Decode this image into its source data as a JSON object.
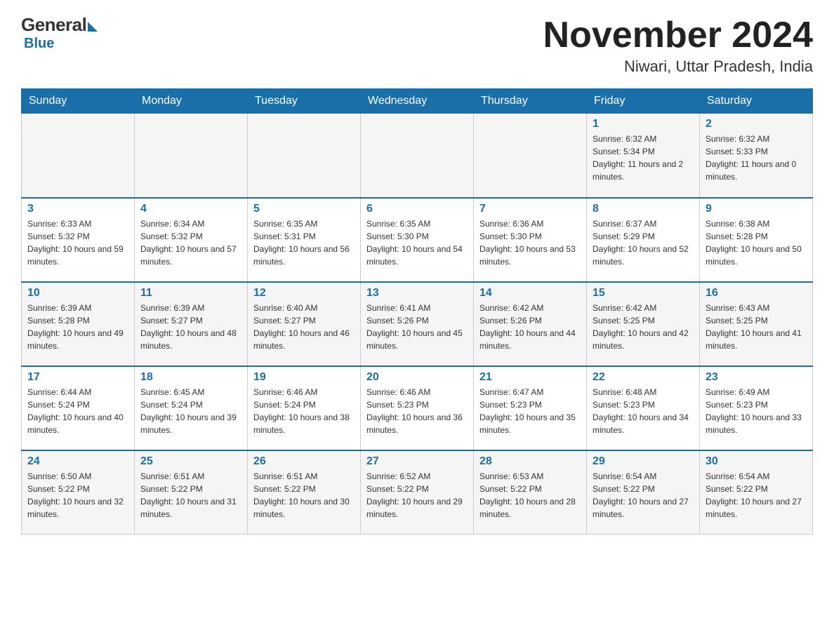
{
  "logo": {
    "general": "General",
    "blue": "Blue"
  },
  "title": {
    "month_year": "November 2024",
    "location": "Niwari, Uttar Pradesh, India"
  },
  "days_of_week": [
    "Sunday",
    "Monday",
    "Tuesday",
    "Wednesday",
    "Thursday",
    "Friday",
    "Saturday"
  ],
  "weeks": [
    [
      {
        "day": "",
        "info": ""
      },
      {
        "day": "",
        "info": ""
      },
      {
        "day": "",
        "info": ""
      },
      {
        "day": "",
        "info": ""
      },
      {
        "day": "",
        "info": ""
      },
      {
        "day": "1",
        "info": "Sunrise: 6:32 AM\nSunset: 5:34 PM\nDaylight: 11 hours and 2 minutes."
      },
      {
        "day": "2",
        "info": "Sunrise: 6:32 AM\nSunset: 5:33 PM\nDaylight: 11 hours and 0 minutes."
      }
    ],
    [
      {
        "day": "3",
        "info": "Sunrise: 6:33 AM\nSunset: 5:32 PM\nDaylight: 10 hours and 59 minutes."
      },
      {
        "day": "4",
        "info": "Sunrise: 6:34 AM\nSunset: 5:32 PM\nDaylight: 10 hours and 57 minutes."
      },
      {
        "day": "5",
        "info": "Sunrise: 6:35 AM\nSunset: 5:31 PM\nDaylight: 10 hours and 56 minutes."
      },
      {
        "day": "6",
        "info": "Sunrise: 6:35 AM\nSunset: 5:30 PM\nDaylight: 10 hours and 54 minutes."
      },
      {
        "day": "7",
        "info": "Sunrise: 6:36 AM\nSunset: 5:30 PM\nDaylight: 10 hours and 53 minutes."
      },
      {
        "day": "8",
        "info": "Sunrise: 6:37 AM\nSunset: 5:29 PM\nDaylight: 10 hours and 52 minutes."
      },
      {
        "day": "9",
        "info": "Sunrise: 6:38 AM\nSunset: 5:28 PM\nDaylight: 10 hours and 50 minutes."
      }
    ],
    [
      {
        "day": "10",
        "info": "Sunrise: 6:39 AM\nSunset: 5:28 PM\nDaylight: 10 hours and 49 minutes."
      },
      {
        "day": "11",
        "info": "Sunrise: 6:39 AM\nSunset: 5:27 PM\nDaylight: 10 hours and 48 minutes."
      },
      {
        "day": "12",
        "info": "Sunrise: 6:40 AM\nSunset: 5:27 PM\nDaylight: 10 hours and 46 minutes."
      },
      {
        "day": "13",
        "info": "Sunrise: 6:41 AM\nSunset: 5:26 PM\nDaylight: 10 hours and 45 minutes."
      },
      {
        "day": "14",
        "info": "Sunrise: 6:42 AM\nSunset: 5:26 PM\nDaylight: 10 hours and 44 minutes."
      },
      {
        "day": "15",
        "info": "Sunrise: 6:42 AM\nSunset: 5:25 PM\nDaylight: 10 hours and 42 minutes."
      },
      {
        "day": "16",
        "info": "Sunrise: 6:43 AM\nSunset: 5:25 PM\nDaylight: 10 hours and 41 minutes."
      }
    ],
    [
      {
        "day": "17",
        "info": "Sunrise: 6:44 AM\nSunset: 5:24 PM\nDaylight: 10 hours and 40 minutes."
      },
      {
        "day": "18",
        "info": "Sunrise: 6:45 AM\nSunset: 5:24 PM\nDaylight: 10 hours and 39 minutes."
      },
      {
        "day": "19",
        "info": "Sunrise: 6:46 AM\nSunset: 5:24 PM\nDaylight: 10 hours and 38 minutes."
      },
      {
        "day": "20",
        "info": "Sunrise: 6:46 AM\nSunset: 5:23 PM\nDaylight: 10 hours and 36 minutes."
      },
      {
        "day": "21",
        "info": "Sunrise: 6:47 AM\nSunset: 5:23 PM\nDaylight: 10 hours and 35 minutes."
      },
      {
        "day": "22",
        "info": "Sunrise: 6:48 AM\nSunset: 5:23 PM\nDaylight: 10 hours and 34 minutes."
      },
      {
        "day": "23",
        "info": "Sunrise: 6:49 AM\nSunset: 5:23 PM\nDaylight: 10 hours and 33 minutes."
      }
    ],
    [
      {
        "day": "24",
        "info": "Sunrise: 6:50 AM\nSunset: 5:22 PM\nDaylight: 10 hours and 32 minutes."
      },
      {
        "day": "25",
        "info": "Sunrise: 6:51 AM\nSunset: 5:22 PM\nDaylight: 10 hours and 31 minutes."
      },
      {
        "day": "26",
        "info": "Sunrise: 6:51 AM\nSunset: 5:22 PM\nDaylight: 10 hours and 30 minutes."
      },
      {
        "day": "27",
        "info": "Sunrise: 6:52 AM\nSunset: 5:22 PM\nDaylight: 10 hours and 29 minutes."
      },
      {
        "day": "28",
        "info": "Sunrise: 6:53 AM\nSunset: 5:22 PM\nDaylight: 10 hours and 28 minutes."
      },
      {
        "day": "29",
        "info": "Sunrise: 6:54 AM\nSunset: 5:22 PM\nDaylight: 10 hours and 27 minutes."
      },
      {
        "day": "30",
        "info": "Sunrise: 6:54 AM\nSunset: 5:22 PM\nDaylight: 10 hours and 27 minutes."
      }
    ]
  ]
}
